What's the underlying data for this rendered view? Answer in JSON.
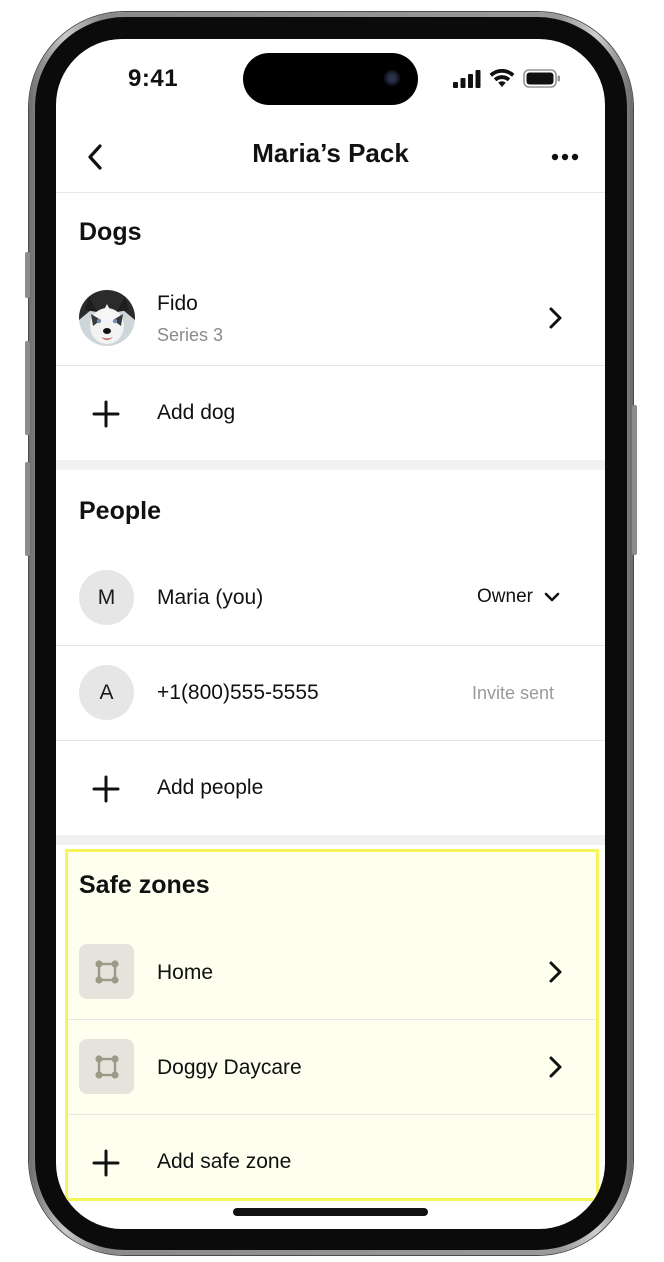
{
  "status_bar": {
    "time": "9:41"
  },
  "nav": {
    "title": "Maria’s Pack"
  },
  "dogs": {
    "title": "Dogs",
    "items": [
      {
        "name": "Fido",
        "subtitle": "Series 3"
      }
    ],
    "add_label": "Add dog"
  },
  "people": {
    "title": "People",
    "items": [
      {
        "initial": "M",
        "name": "Maria (you)",
        "role": "Owner"
      },
      {
        "initial": "A",
        "name": "+1(800)555-5555",
        "status": "Invite sent"
      }
    ],
    "add_label": "Add people"
  },
  "safe_zones": {
    "title": "Safe zones",
    "items": [
      {
        "name": "Home"
      },
      {
        "name": "Doggy Daycare"
      }
    ],
    "add_label": "Add safe zone"
  },
  "colors": {
    "highlight_fill": "#fffff0",
    "highlight_border": "#f5f55a",
    "zone_icon_bg": "#e4e4dc",
    "secondary_text": "#8a8a8a"
  }
}
